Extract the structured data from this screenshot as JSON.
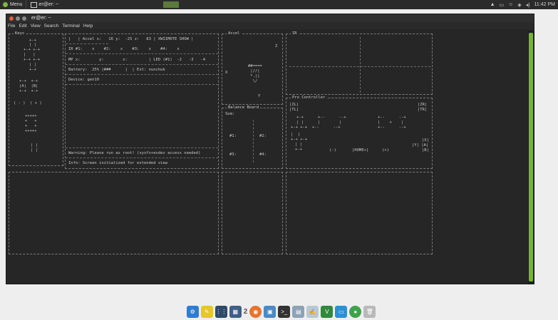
{
  "top_panel": {
    "menu_label": "Menu",
    "task_label": "er@er: ~",
    "clock": "11:42 PM"
  },
  "window": {
    "title": "er@er: ~",
    "menu": [
      "File",
      "Edit",
      "View",
      "Search",
      "Terminal",
      "Help"
    ]
  },
  "keys": {
    "title": "Keys",
    "rows": [
      "+-+",
      "| |",
      "+-+ +-+",
      "|   |",
      "+-+ +-+",
      "| |",
      "+-+",
      "",
      "+-+  +-+",
      "|A|  |B|",
      "+-+  +-+",
      "",
      "( - )  ( + )",
      "",
      "+++++",
      "+   +",
      "+   +",
      "+++++",
      "",
      "",
      "| |",
      "| |"
    ]
  },
  "main": {
    "accel_line": "|   | Accel x:   16 y:  -25 z:   83 | XWIIMOTE SHOW |",
    "ir_line": "IR #1:    x    #2:    x    #3:    x    #4:    x",
    "mp_line": "MP x:        y:        z:         | LED (#1)  -2   -3   -4",
    "battery_line": "Battery:  25% |###      |  | Ext: nunchuk",
    "device_line": "Device: gen10",
    "warning_line": "Warning: Please run as root! (sysfs+evdev access needed)",
    "info_line": "Info: Screen initialized for extended view"
  },
  "accel": {
    "title": "Accel",
    "z_label": "Z",
    "x_label": "X",
    "y_label": "Y",
    "art": [
      "##====",
      " |//|",
      " *.||",
      "  \\/"
    ]
  },
  "balance": {
    "title": "Balance Board",
    "sum_label": "Sum:",
    "n1": "#1:",
    "n2": "#2:",
    "n3": "#3:",
    "n4": "#4:"
  },
  "ir": {
    "title": "IR"
  },
  "pro": {
    "title": "Pro Controller",
    "zl": "|ZL|",
    "tl": "|TL|",
    "zr": "|ZR|",
    "tr": "|TR|",
    "minus": "(-)",
    "home": "|HOME+|",
    "plus": "(+)",
    "x": "|X|",
    "y_a": "|Y| |A|",
    "b": "|B|"
  },
  "dock": {
    "workspace_label": "2"
  },
  "colors": {
    "accent": "#76b52f",
    "terminal_bg": "#262626",
    "text": "#c8c8c8"
  }
}
